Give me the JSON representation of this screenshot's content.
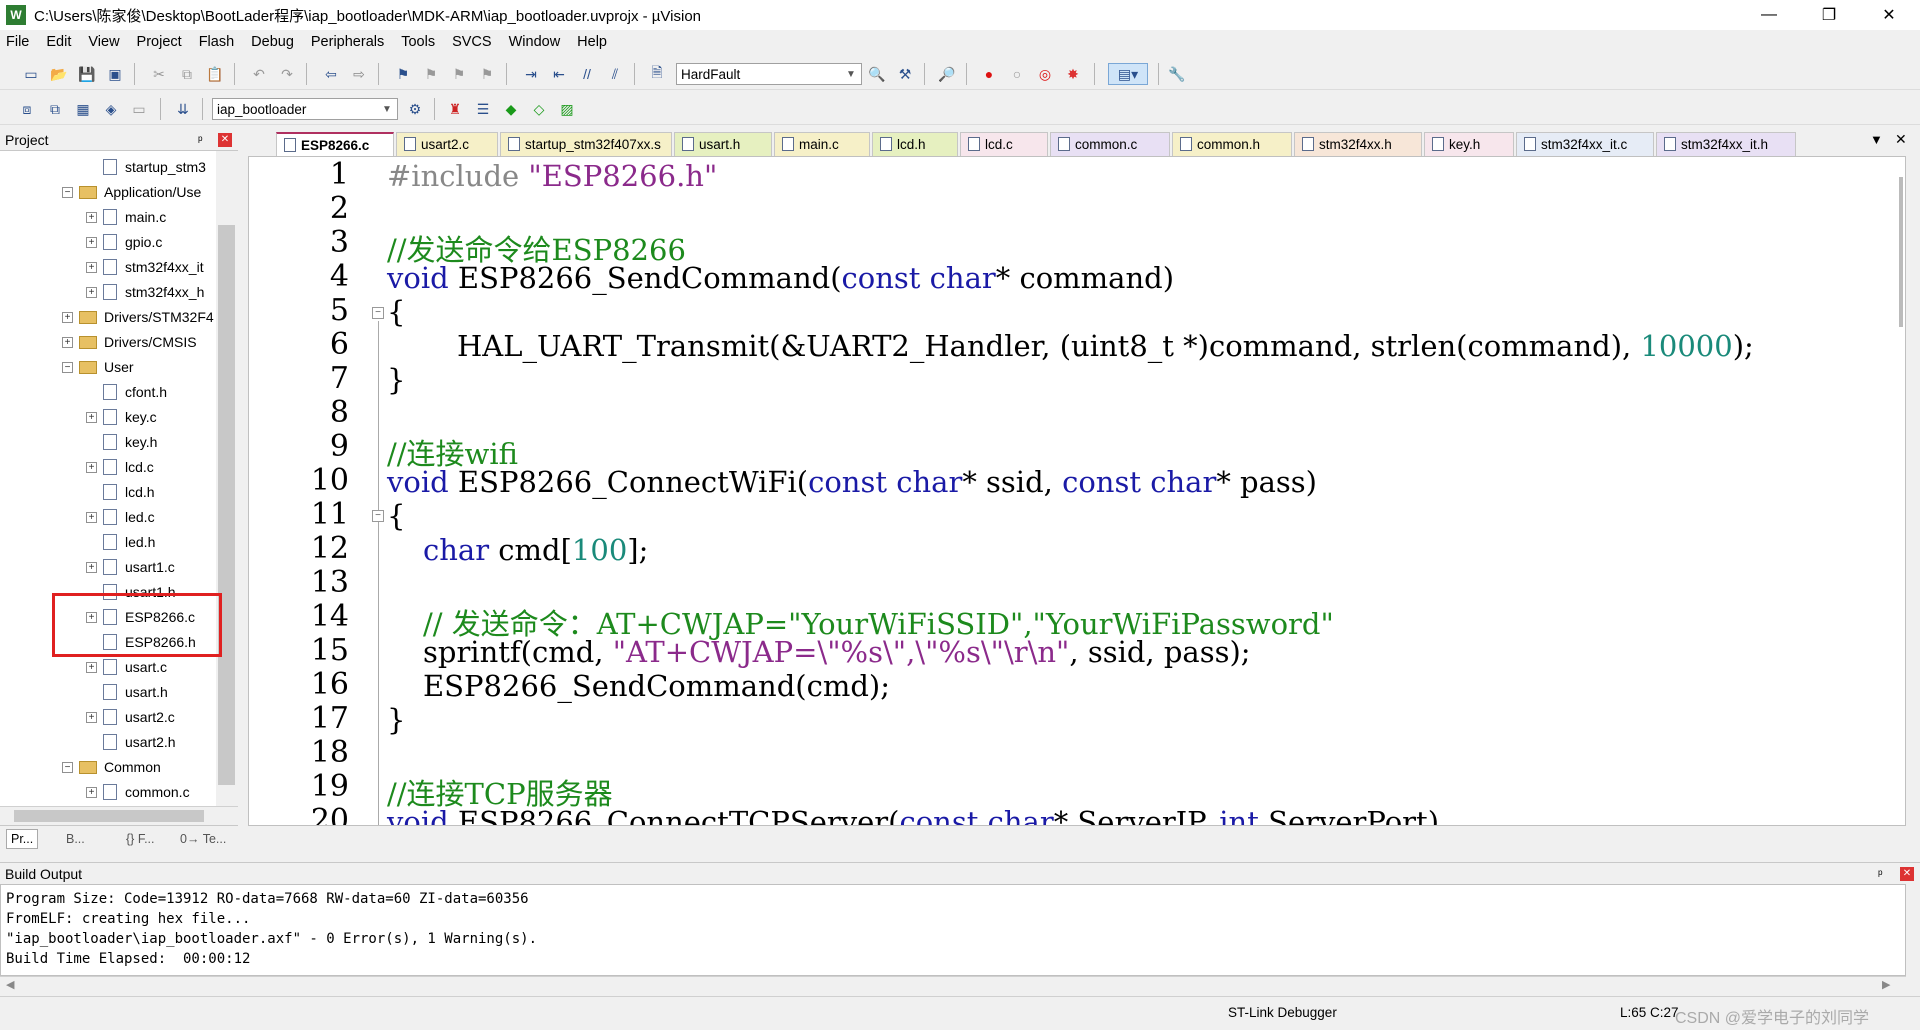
{
  "window": {
    "title": "C:\\Users\\陈家俊\\Desktop\\BootLader程序\\iap_bootloader\\MDK-ARM\\iap_bootloader.uvprojx - µVision",
    "app_icon": "W",
    "minimize": "—",
    "maximize": "❐",
    "close": "✕"
  },
  "menu": [
    "File",
    "Edit",
    "View",
    "Project",
    "Flash",
    "Debug",
    "Peripherals",
    "Tools",
    "SVCS",
    "Window",
    "Help"
  ],
  "toolbar": {
    "find_combo": "HardFault",
    "target_combo": "iap_bootloader"
  },
  "project_panel": {
    "title": "Project",
    "pin": "ᵖ",
    "close": "✕",
    "tree": [
      {
        "label": "startup_stm3",
        "type": "file",
        "level": 3,
        "expander": ""
      },
      {
        "label": "Application/Use",
        "type": "folder",
        "level": 2,
        "expander": "−"
      },
      {
        "label": "main.c",
        "type": "file",
        "level": 3,
        "expander": "+"
      },
      {
        "label": "gpio.c",
        "type": "file",
        "level": 3,
        "expander": "+"
      },
      {
        "label": "stm32f4xx_it",
        "type": "file",
        "level": 3,
        "expander": "+"
      },
      {
        "label": "stm32f4xx_h",
        "type": "file",
        "level": 3,
        "expander": "+"
      },
      {
        "label": "Drivers/STM32F4",
        "type": "folder",
        "level": 2,
        "expander": "+"
      },
      {
        "label": "Drivers/CMSIS",
        "type": "folder",
        "level": 2,
        "expander": "+"
      },
      {
        "label": "User",
        "type": "folder",
        "level": 2,
        "expander": "−"
      },
      {
        "label": "cfont.h",
        "type": "file",
        "level": 3,
        "expander": ""
      },
      {
        "label": "key.c",
        "type": "file",
        "level": 3,
        "expander": "+"
      },
      {
        "label": "key.h",
        "type": "file",
        "level": 3,
        "expander": ""
      },
      {
        "label": "lcd.c",
        "type": "file",
        "level": 3,
        "expander": "+"
      },
      {
        "label": "lcd.h",
        "type": "file",
        "level": 3,
        "expander": ""
      },
      {
        "label": "led.c",
        "type": "file",
        "level": 3,
        "expander": "+"
      },
      {
        "label": "led.h",
        "type": "file",
        "level": 3,
        "expander": ""
      },
      {
        "label": "usart1.c",
        "type": "file",
        "level": 3,
        "expander": "+"
      },
      {
        "label": "usart1.h",
        "type": "file",
        "level": 3,
        "expander": ""
      },
      {
        "label": "ESP8266.c",
        "type": "file",
        "level": 3,
        "expander": "+"
      },
      {
        "label": "ESP8266.h",
        "type": "file",
        "level": 3,
        "expander": ""
      },
      {
        "label": "usart.c",
        "type": "file",
        "level": 3,
        "expander": "+"
      },
      {
        "label": "usart.h",
        "type": "file",
        "level": 3,
        "expander": ""
      },
      {
        "label": "usart2.c",
        "type": "file",
        "level": 3,
        "expander": "+"
      },
      {
        "label": "usart2.h",
        "type": "file",
        "level": 3,
        "expander": ""
      },
      {
        "label": "Common",
        "type": "folder",
        "level": 2,
        "expander": "−"
      },
      {
        "label": "common.c",
        "type": "file",
        "level": 3,
        "expander": "+"
      }
    ],
    "bottom_tabs": [
      "Pr...",
      "B...",
      "{} F...",
      "0→ Te..."
    ]
  },
  "editor_tabs": [
    {
      "label": "ESP8266.c",
      "active": true,
      "color": "#f7e6ec"
    },
    {
      "label": "usart2.c",
      "active": false,
      "color": "#f6f0c8"
    },
    {
      "label": "startup_stm32f407xx.s",
      "active": false,
      "color": "#f6f0c8"
    },
    {
      "label": "usart.h",
      "active": false,
      "color": "#e6f0c0"
    },
    {
      "label": "main.c",
      "active": false,
      "color": "#f6f0c8"
    },
    {
      "label": "lcd.h",
      "active": false,
      "color": "#e6f0c0"
    },
    {
      "label": "lcd.c",
      "active": false,
      "color": "#f7e6ec"
    },
    {
      "label": "common.c",
      "active": false,
      "color": "#e8e0f4"
    },
    {
      "label": "common.h",
      "active": false,
      "color": "#f6f0c8"
    },
    {
      "label": "stm32f4xx.h",
      "active": false,
      "color": "#f7e6d8"
    },
    {
      "label": "key.h",
      "active": false,
      "color": "#f7e6ec"
    },
    {
      "label": "stm32f4xx_it.c",
      "active": false,
      "color": "#e6ecf6"
    },
    {
      "label": "stm32f4xx_it.h",
      "active": false,
      "color": "#e8e0f4"
    }
  ],
  "code_lines": [
    "1",
    "2",
    "3",
    "4",
    "5",
    "6",
    "7",
    "8",
    "9",
    "10",
    "11",
    "12",
    "13",
    "14",
    "15",
    "16",
    "17",
    "18",
    "19",
    "20"
  ],
  "code": {
    "l1_pp": "#include",
    "l1_str": "\"ESP8266.h\"",
    "l3": "//发送命令给ESP8266",
    "l4_void": "void",
    "l4_fn": "ESP8266_SendCommand(",
    "l4_const": "const",
    "l4_char": "char",
    "l4_rest": "* command)",
    "l5": "{",
    "l6_a": "HAL_UART_Transmit(&UART2_Handler, (uint8_t *)command, strlen(command), ",
    "l6_num": "10000",
    "l6_b": ");",
    "l7": "}",
    "l9": "//连接wifi",
    "l10_void": "void",
    "l10_fn": "ESP8266_ConnectWiFi(",
    "l10_const1": "const",
    "l10_char1": "char",
    "l10_mid": "* ssid, ",
    "l10_const2": "const",
    "l10_char2": "char",
    "l10_rest": "* pass)",
    "l11": "{",
    "l12_char": "char",
    "l12_a": " cmd[",
    "l12_num": "100",
    "l12_b": "];",
    "l14": "// 发送命令：AT+CWJAP=\"YourWiFiSSID\",\"YourWiFiPassword\"",
    "l15_a": "sprintf(cmd, ",
    "l15_str": "\"AT+CWJAP=\\\"%s\\\",\\\"%s\\\"\\r\\n\"",
    "l15_b": ", ssid, pass);",
    "l16": "ESP8266_SendCommand(cmd);",
    "l17": "}",
    "l19": "//连接TCP服务器",
    "l20_void": "void",
    "l20_fn": "ESP8266_ConnectTCPServer(",
    "l20_const": "const",
    "l20_char": "char",
    "l20_mid": "* ServerIP, ",
    "l20_int": "int",
    "l20_rest": " ServerPort)"
  },
  "build_output": {
    "title": "Build Output",
    "lines": [
      "Program Size: Code=13912 RO-data=7668 RW-data=60 ZI-data=60356",
      "FromELF: creating hex file...",
      "\"iap_bootloader\\iap_bootloader.axf\" - 0 Error(s), 1 Warning(s).",
      "Build Time Elapsed:  00:00:12"
    ]
  },
  "status": {
    "debugger": "ST-Link Debugger",
    "position": "L:65 C:27",
    "watermark": "CSDN @爱学电子的刘同学"
  },
  "colors": {
    "highlight_box": "#e02020",
    "comment": "#1d8a1d",
    "keyword": "#1a1aa6",
    "string": "#8b2a8b",
    "number": "#1a8a7a"
  }
}
